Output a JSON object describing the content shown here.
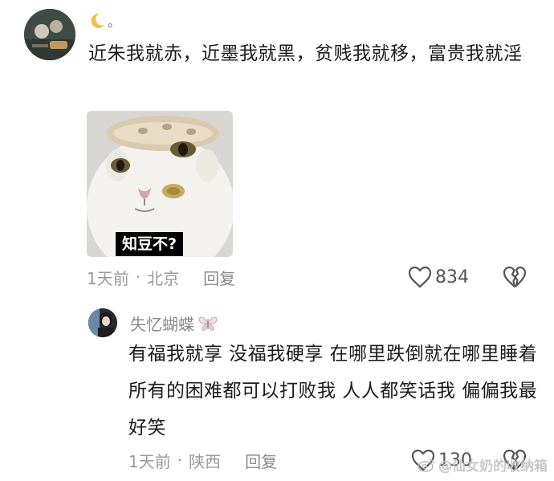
{
  "comment_main": {
    "username_suffix": "。",
    "username_icon": "crescent-moon-icon",
    "text": "近朱我就赤，近墨我就黑，贫贱我就移，富贵我就淫",
    "sticker_caption": "知豆不?",
    "time": "1天前",
    "location": "北京",
    "reply_label": "回复",
    "likes": "834"
  },
  "comment_reply": {
    "username": "失忆蝴蝶",
    "username_icon": "butterfly-icon",
    "text": "有福我就享 没福我硬享 在哪里跌倒就在哪里睡着 所有的困难都可以打败我 人人都笑话我 偏偏我最好笑",
    "time": "1天前",
    "location": "陕西",
    "reply_label": "回复",
    "likes": "130"
  },
  "separator": "·",
  "watermark": "@仙女奶的收纳箱",
  "colors": {
    "meta_gray": "#9a9a9a",
    "text": "#1b1b1b",
    "moon": "#f2c14e"
  }
}
